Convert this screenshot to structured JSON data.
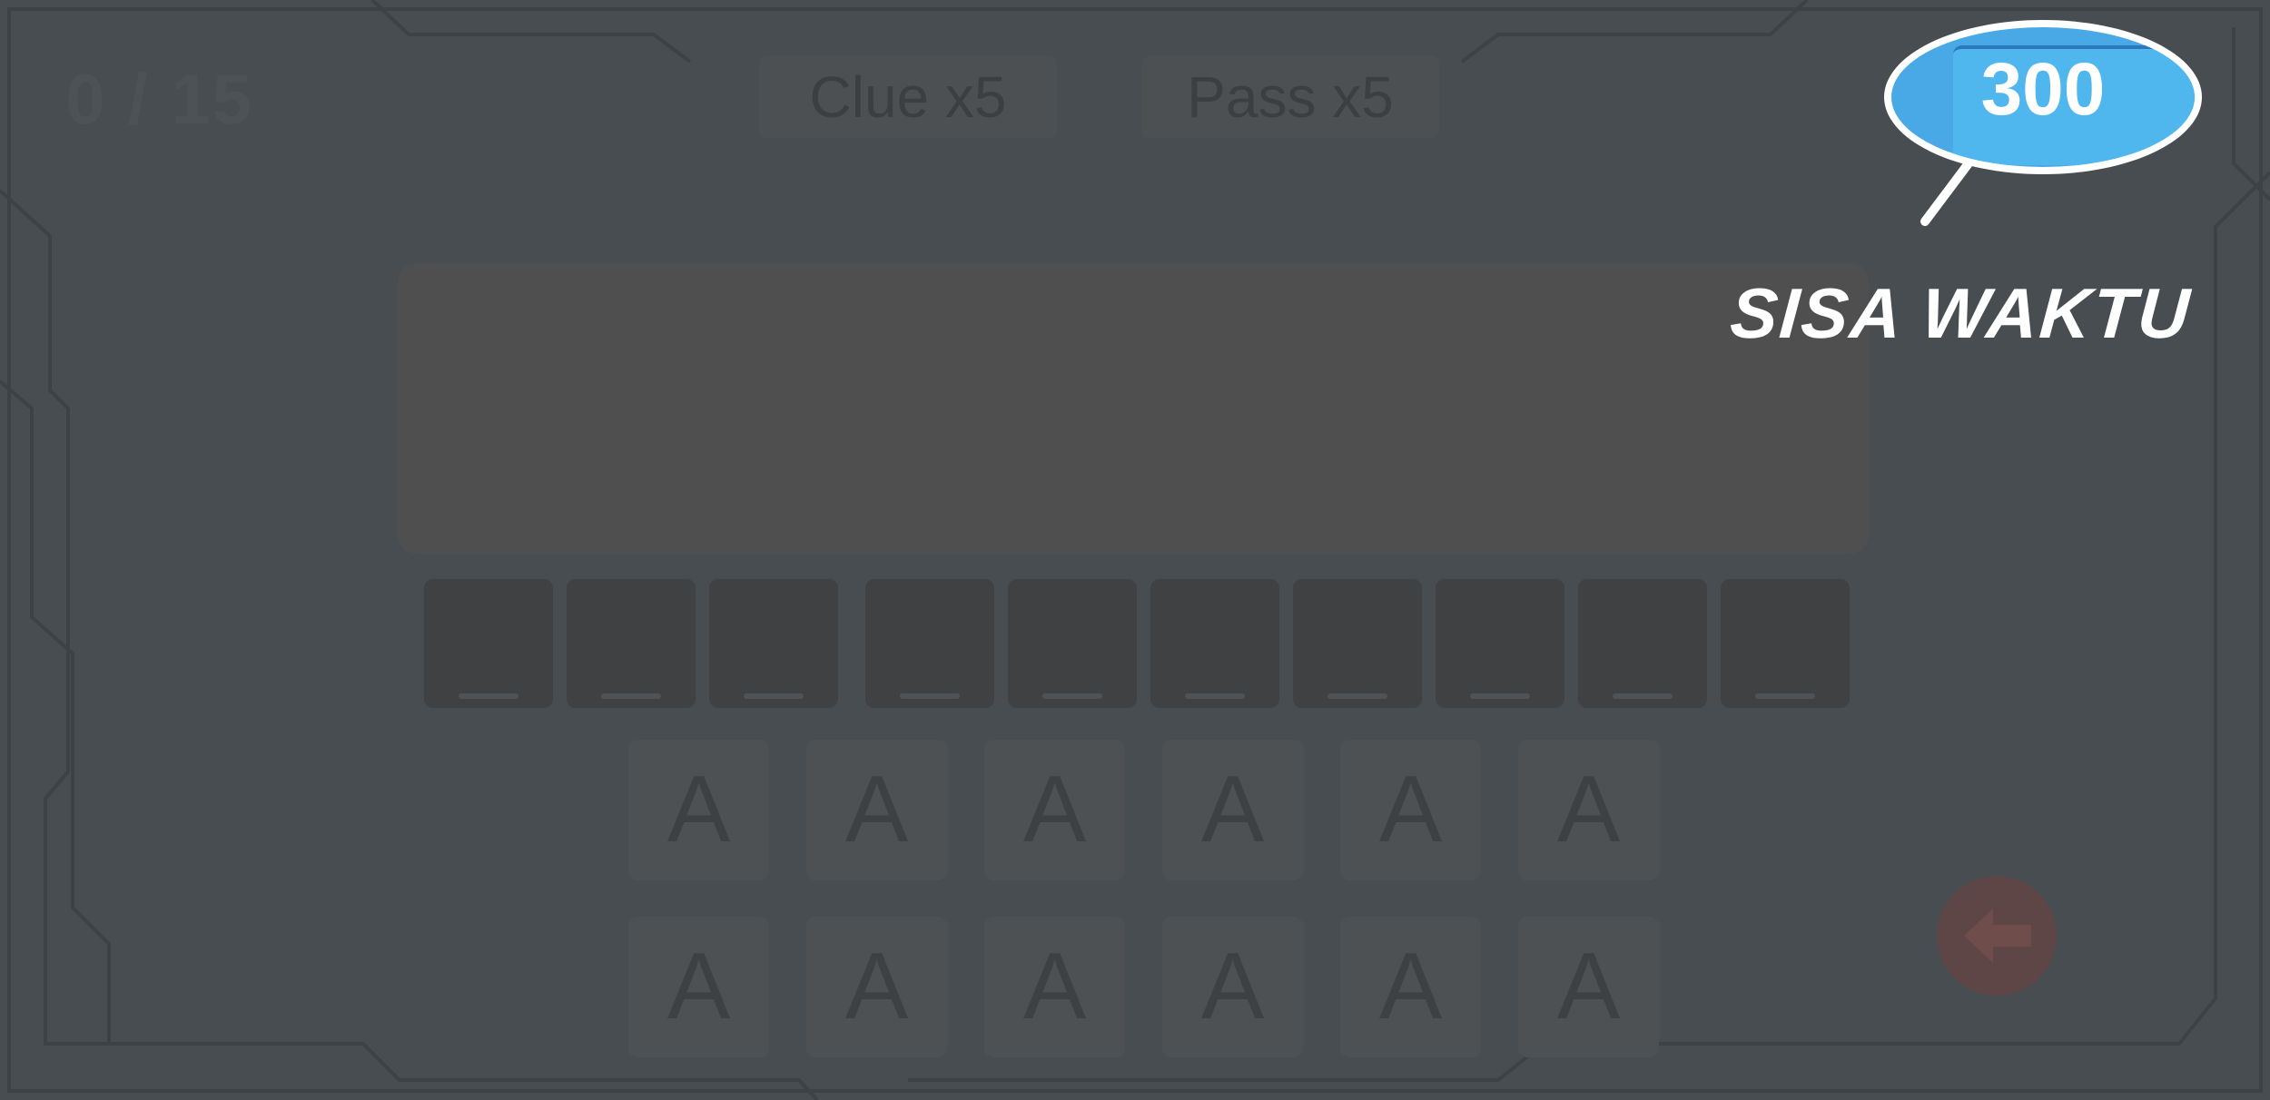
{
  "hud": {
    "score": "0 / 15",
    "clue_label": "Clue x5",
    "pass_label": "Pass x5"
  },
  "answer_slots": [
    "_",
    "_",
    "_",
    "_",
    "_",
    "_",
    "_",
    "_",
    "_",
    "_"
  ],
  "letter_keys": {
    "row1": [
      "A",
      "A",
      "A",
      "A",
      "A",
      "A"
    ],
    "row2": [
      "A",
      "A",
      "A",
      "A",
      "A",
      "A"
    ]
  },
  "timer": {
    "value": "300",
    "label": "SISA WAKTU"
  },
  "icons": {
    "back": "arrow-left-icon"
  },
  "colors": {
    "overlay": "#484d51",
    "timer_bubble": "#49a9e6",
    "back_button": "#5d4645"
  }
}
